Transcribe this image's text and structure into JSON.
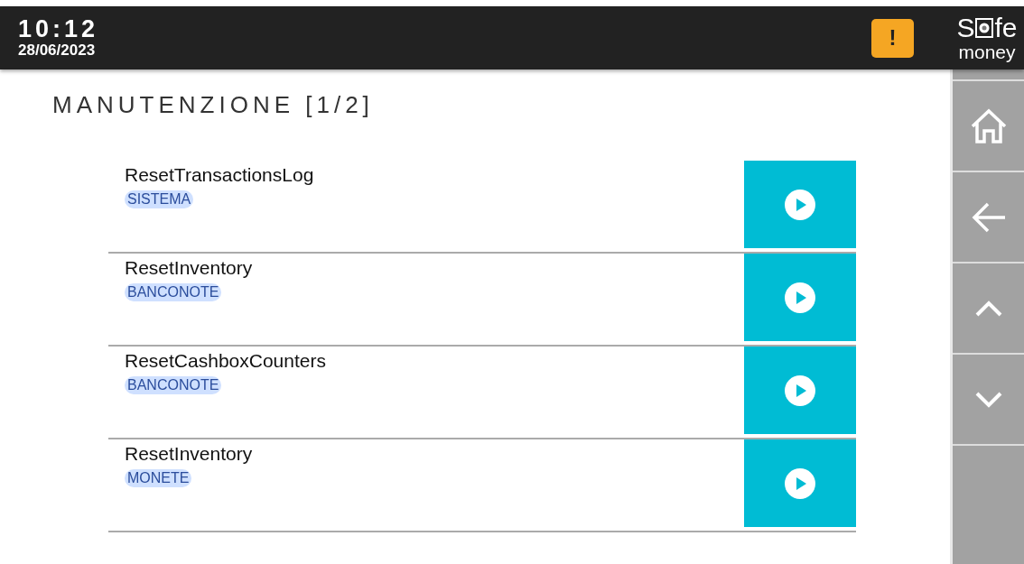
{
  "status_bar": {
    "time": "10:12",
    "date": "28/06/2023",
    "alert": "!",
    "logo": {
      "first": "S",
      "rest": "fe",
      "second_line": "money"
    }
  },
  "title": "MANUTENZIONE [1/2]",
  "operations": [
    {
      "name": "ResetTransactionsLog",
      "tag": "SISTEMA"
    },
    {
      "name": "ResetInventory",
      "tag": "BANCONOTE"
    },
    {
      "name": "ResetCashboxCounters",
      "tag": "BANCONOTE"
    },
    {
      "name": "ResetInventory",
      "tag": "MONETE"
    }
  ],
  "sidebar": {
    "items": [
      {
        "kind": "home"
      },
      {
        "kind": "back"
      },
      {
        "kind": "up"
      },
      {
        "kind": "down"
      }
    ]
  }
}
